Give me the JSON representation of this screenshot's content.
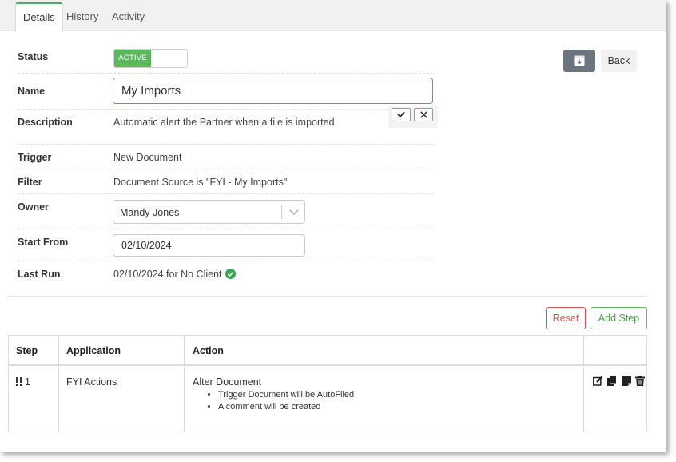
{
  "tabs": [
    "Details",
    "History",
    "Activity"
  ],
  "form": {
    "status_label": "Status",
    "status_toggle": "ACTIVE",
    "name_label": "Name",
    "name_value": "My Imports",
    "description_label": "Description",
    "description_value": "Automatic alert the Partner when a file is imported",
    "trigger_label": "Trigger",
    "trigger_value": "New Document",
    "filter_label": "Filter",
    "filter_value": "Document Source is \"FYI - My Imports\"",
    "owner_label": "Owner",
    "owner_value": "Mandy Jones",
    "start_label": "Start From",
    "start_value": "02/10/2024",
    "lastrun_label": "Last Run",
    "lastrun_value": "02/10/2024 for No Client"
  },
  "header_buttons": {
    "back": "Back",
    "archive_icon": "archive-icon"
  },
  "steps_toolbar": {
    "reset": "Reset",
    "add_step": "Add Step"
  },
  "table": {
    "headers": [
      "Step",
      "Application",
      "Action"
    ],
    "rows": [
      {
        "step": "1",
        "application": "FYI Actions",
        "action": "Alter Document",
        "details": [
          "Trigger Document will be AutoFiled",
          "A comment will be created"
        ]
      }
    ]
  },
  "colors": {
    "active_green": "#5cb85c",
    "focus_blue": "#4f8fdf",
    "reset_red": "#d9534f",
    "archive_grey": "#6c757d"
  }
}
